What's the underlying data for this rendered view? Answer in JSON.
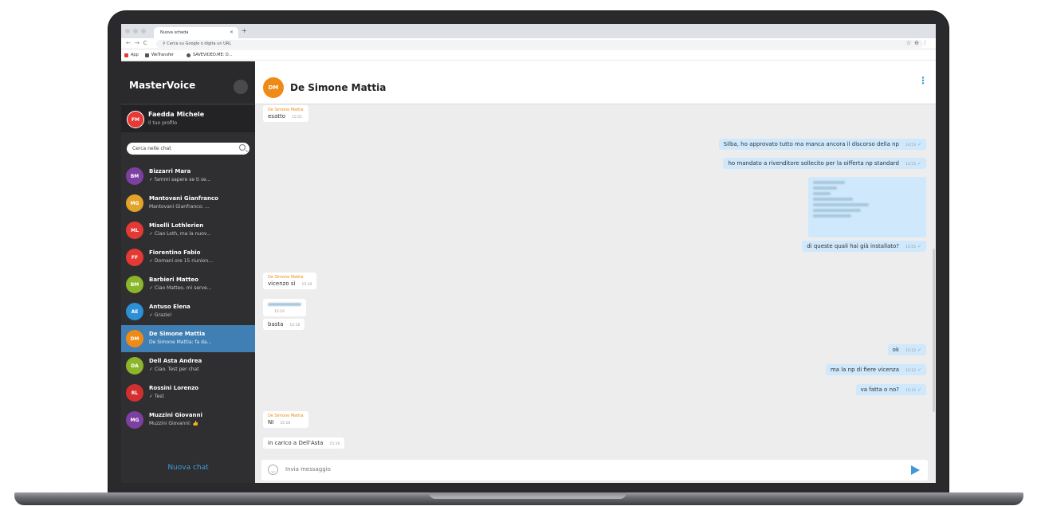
{
  "browser": {
    "tab_title": "Nuova scheda",
    "tab_close": "×",
    "new_tab": "+",
    "omnibox_placeholder": "Cerca su Google o digita un URL",
    "bookmarks": [
      "App",
      "WeTransfer",
      "SAVEVIDEO.ME: D..."
    ]
  },
  "sidebar": {
    "brand": "MasterVoice",
    "profile": {
      "initials": "FM",
      "name": "Faedda Michele",
      "subtitle": "Il tuo profilo",
      "color": "#e53935"
    },
    "search_placeholder": "Cerca nelle chat",
    "chats": [
      {
        "initials": "BM",
        "name": "Bizzarri Mara",
        "preview": "✓ fammi sapere se ti se...",
        "color": "#7e3fa3",
        "active": false
      },
      {
        "initials": "MG",
        "name": "Mantovani Gianfranco",
        "preview": "Mantovani Gianfranco: ...",
        "color": "#e3a32a",
        "active": false
      },
      {
        "initials": "ML",
        "name": "Miselli Lothlerien",
        "preview": "✓ Ciao Loth, ma la nuov...",
        "color": "#e53935",
        "active": false
      },
      {
        "initials": "FF",
        "name": "Fiorentino Fabio",
        "preview": "✓ Domani ore 15 riunion...",
        "color": "#e53935",
        "active": false
      },
      {
        "initials": "BM",
        "name": "Barbieri Matteo",
        "preview": "✓ Ciao Matteo, mi serve...",
        "color": "#8bb62a",
        "active": false
      },
      {
        "initials": "AE",
        "name": "Antuso Elena",
        "preview": "✓ Grazie!",
        "color": "#2d8fd5",
        "active": false
      },
      {
        "initials": "DM",
        "name": "De Simone Mattia",
        "preview": "De Simone Mattia: fa da...",
        "color": "#ef8a16",
        "active": true
      },
      {
        "initials": "DA",
        "name": "Dell Asta Andrea",
        "preview": "✓ Ciao. Test per chat",
        "color": "#8bb62a",
        "active": false
      },
      {
        "initials": "RL",
        "name": "Rossini Lorenzo",
        "preview": "✓ Test",
        "color": "#d32f2f",
        "active": false
      },
      {
        "initials": "MG",
        "name": "Muzzini Giovanni",
        "preview": "Muzzini Giovanni: 👍",
        "color": "#7e3fa3",
        "active": false
      }
    ],
    "new_chat_label": "Nuova chat"
  },
  "chat": {
    "contact_initials": "DM",
    "contact_name": "De Simone Mattia",
    "menu_icon": "⋮",
    "messages": [
      {
        "dir": "in",
        "sender": "De Simone Mattia",
        "text": "esatto",
        "time": "15:51"
      },
      {
        "dir": "out",
        "text": "Silba, ho approvato tutto ma manca ancora il discorso della np",
        "time": "14:53"
      },
      {
        "dir": "out",
        "text": "ho mandato a rivenditore sollecito per la oifferta np standard",
        "time": "14:53"
      },
      {
        "dir": "out",
        "text": "",
        "time": "",
        "blurred": true
      },
      {
        "dir": "out",
        "text": "di queste quali hai già installato?",
        "time": "14:55"
      },
      {
        "dir": "in",
        "sender": "De Simone Mattia",
        "text": "vicenzo si",
        "time": "15:10"
      },
      {
        "dir": "in",
        "text": "",
        "time": "15:10",
        "blurred": true
      },
      {
        "dir": "in",
        "text": "basta",
        "time": "15:10"
      },
      {
        "dir": "out",
        "text": "ok",
        "time": "15:12"
      },
      {
        "dir": "out",
        "text": "ma la np di fiere vicenza",
        "time": "15:12"
      },
      {
        "dir": "out",
        "text": "va fatta o no?",
        "time": "15:12"
      },
      {
        "dir": "in",
        "sender": "De Simone Mattia",
        "text": "NI",
        "time": "15:16"
      },
      {
        "dir": "in",
        "text": "in carico a Dell'Asta",
        "time": "15:16"
      }
    ],
    "composer_placeholder": "Invia messaggio"
  }
}
